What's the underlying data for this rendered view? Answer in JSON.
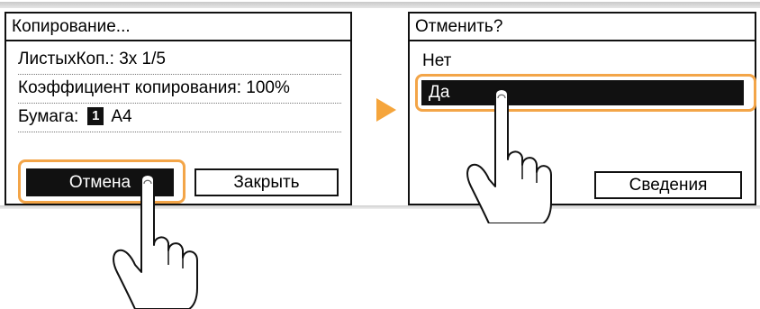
{
  "copy_screen": {
    "title": "Копирование...",
    "rows": [
      {
        "label": "ЛистыхКоп.: 3х 1/5"
      },
      {
        "label": "Коэффициент копирования: 100%"
      },
      {
        "label": "Бумага:",
        "badge": "1",
        "value": "A4"
      }
    ],
    "cancel_button": "Отмена",
    "close_button": "Закрыть"
  },
  "confirm_screen": {
    "title": "Отменить?",
    "options": [
      "Нет",
      "Да"
    ],
    "selected_index": 1,
    "details_button": "Сведения"
  },
  "colors": {
    "highlight": "#f3a548",
    "arrow": "#f5a53c",
    "screen_border": "#111111"
  },
  "icons": [
    "next-arrow-icon",
    "pointing-hand-icon"
  ]
}
